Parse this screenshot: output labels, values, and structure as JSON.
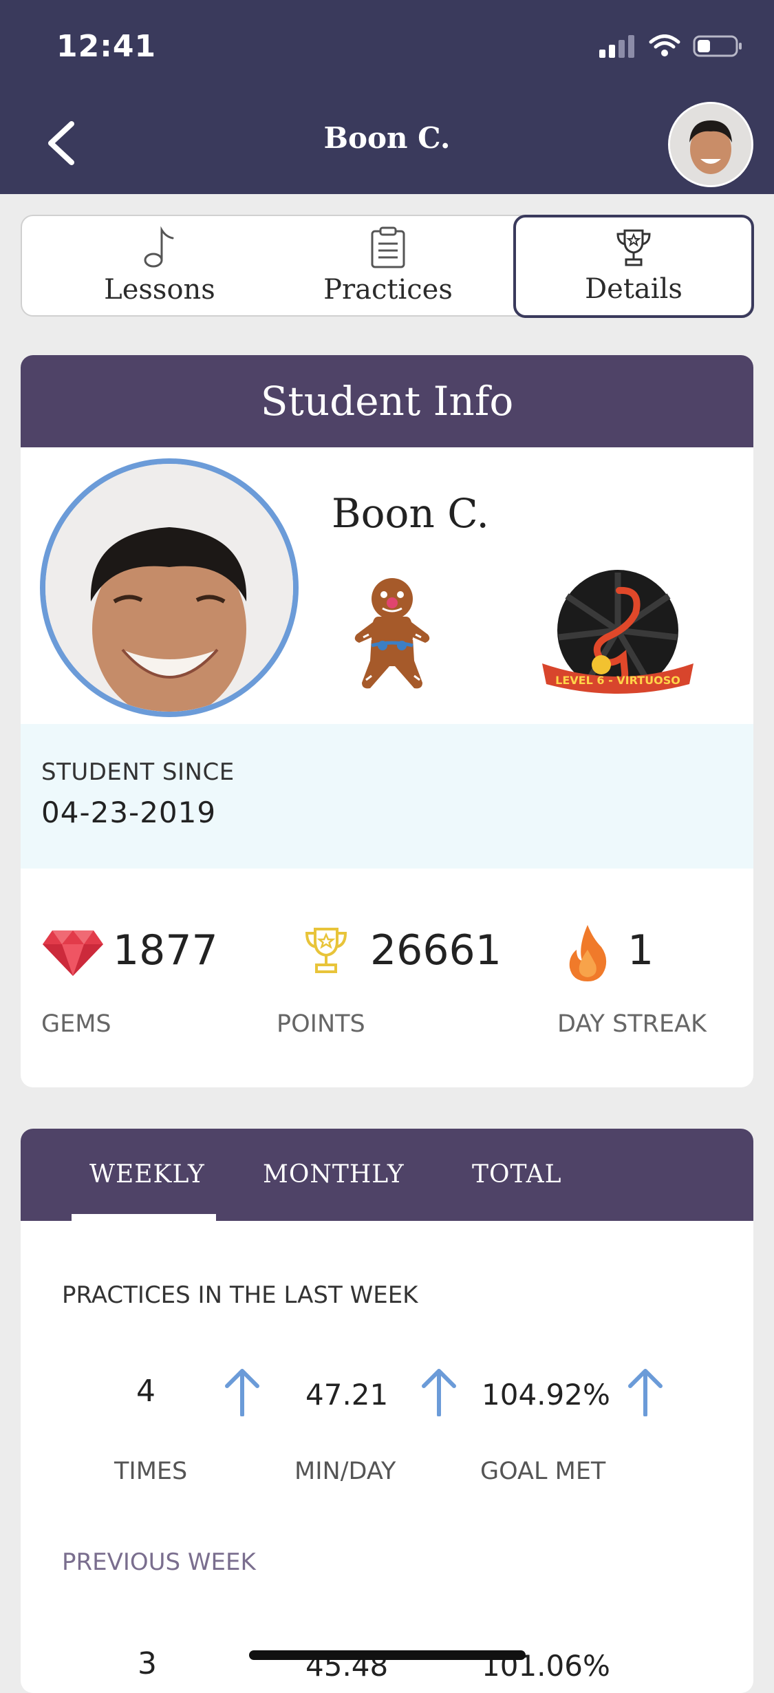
{
  "status_bar": {
    "time": "12:41"
  },
  "header": {
    "title": "Boon C."
  },
  "tabs": [
    {
      "label": "Lessons",
      "icon": "music-note-icon"
    },
    {
      "label": "Practices",
      "icon": "clipboard-icon"
    },
    {
      "label": "Details",
      "icon": "trophy-icon",
      "active": true
    }
  ],
  "student_info": {
    "heading": "Student Info",
    "name": "Boon C.",
    "badge_level_text": "LEVEL 6 - VIRTUOSO",
    "since_label": "STUDENT SINCE",
    "since_value": "04-23-2019",
    "stats": [
      {
        "value": "1877",
        "label": "GEMS",
        "icon": "gem-icon"
      },
      {
        "value": "26661",
        "label": "POINTS",
        "icon": "trophy-icon"
      },
      {
        "value": "1",
        "label": "DAY STREAK",
        "icon": "flame-icon"
      }
    ]
  },
  "progress": {
    "periods": [
      "WEEKLY",
      "MONTHLY",
      "TOTAL"
    ],
    "active_period": "WEEKLY",
    "last_week_title": "PRACTICES IN THE LAST WEEK",
    "last_week": [
      {
        "value": "4",
        "label": "TIMES",
        "trend": "up"
      },
      {
        "value": "47.21",
        "label": "MIN/DAY",
        "trend": "up"
      },
      {
        "value": "104.92%",
        "label": "GOAL MET",
        "trend": "up"
      }
    ],
    "previous_week_title": "PREVIOUS WEEK",
    "previous_week": [
      {
        "value": "3"
      },
      {
        "value": "45.48"
      },
      {
        "value": "101.06%"
      }
    ]
  },
  "colors": {
    "header_bg": "#3a3a5c",
    "card_header_bg": "#4f4367",
    "accent_blue": "#6b9bd8",
    "since_band_bg": "#eef9fc"
  }
}
